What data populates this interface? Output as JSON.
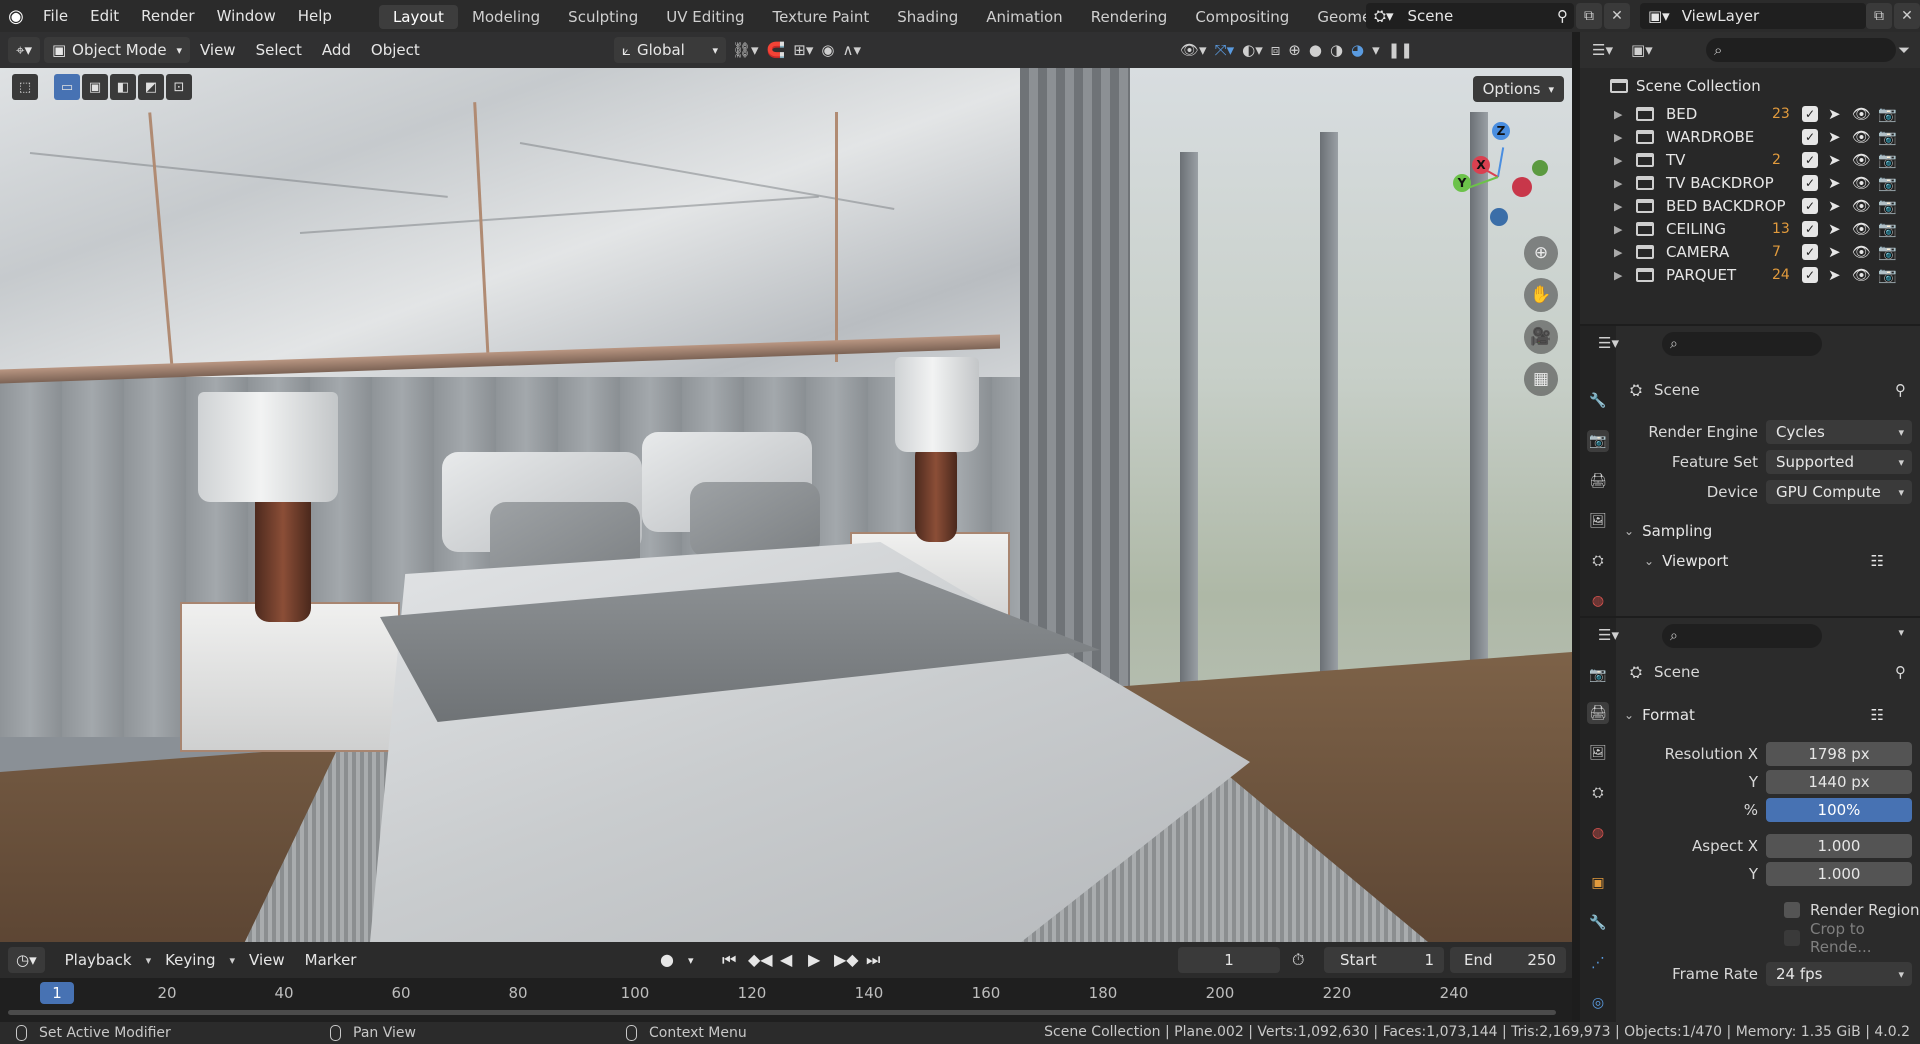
{
  "topbar": {
    "menus": [
      "File",
      "Edit",
      "Render",
      "Window",
      "Help"
    ],
    "workspaces": [
      "Layout",
      "Modeling",
      "Sculpting",
      "UV Editing",
      "Texture Paint",
      "Shading",
      "Animation",
      "Rendering",
      "Compositing",
      "Geomet"
    ],
    "active_workspace": "Layout",
    "scene_name": "Scene",
    "view_layer": "ViewLayer"
  },
  "viewport": {
    "mode": "Object Mode",
    "menus": [
      "View",
      "Select",
      "Add",
      "Object"
    ],
    "transform_orientation": "Global",
    "options_label": "Options",
    "gizmo": {
      "z": "Z",
      "x": "X",
      "y": "Y"
    }
  },
  "timeline": {
    "menus": [
      "Playback",
      "Keying",
      "View",
      "Marker"
    ],
    "current_frame": "1",
    "start_label": "Start",
    "start_value": "1",
    "end_label": "End",
    "end_value": "250",
    "ruler_ticks": [
      "20",
      "40",
      "60",
      "80",
      "100",
      "120",
      "140",
      "160",
      "180",
      "200",
      "220",
      "240"
    ],
    "cursor_frame": "1"
  },
  "statusbar": {
    "hint1": "Set Active Modifier",
    "hint2": "Pan View",
    "hint3": "Context Menu",
    "stats": "Scene Collection | Plane.002 | Verts:1,092,630 | Faces:1,073,144 | Tris:2,169,973 | Objects:1/470 | Memory: 1.35 GiB | 4.0.2"
  },
  "outliner": {
    "root": "Scene Collection",
    "items": [
      {
        "name": "BED",
        "badge": "23"
      },
      {
        "name": "WARDROBE",
        "badge": ""
      },
      {
        "name": "TV",
        "badge": "2"
      },
      {
        "name": "TV BACKDROP",
        "badge": ""
      },
      {
        "name": "BED BACKDROP",
        "badge": ""
      },
      {
        "name": "CEILING",
        "badge": "13"
      },
      {
        "name": "CAMERA",
        "badge": "7"
      },
      {
        "name": "PARQUET",
        "badge": "24"
      }
    ]
  },
  "render_props": {
    "title": "Scene",
    "render_engine_label": "Render Engine",
    "render_engine": "Cycles",
    "feature_set_label": "Feature Set",
    "feature_set": "Supported",
    "device_label": "Device",
    "device": "GPU Compute",
    "sampling": "Sampling",
    "viewport": "Viewport"
  },
  "output_props": {
    "title": "Scene",
    "format": "Format",
    "res_x_label": "Resolution X",
    "res_x": "1798 px",
    "res_y_label": "Y",
    "res_y": "1440 px",
    "pct_label": "%",
    "pct": "100%",
    "aspect_x_label": "Aspect X",
    "aspect_x": "1.000",
    "aspect_y_label": "Y",
    "aspect_y": "1.000",
    "render_region": "Render Region",
    "crop": "Crop to Rende...",
    "frame_rate_label": "Frame Rate",
    "frame_rate": "24 fps"
  },
  "colors": {
    "accent": "#4772b3",
    "badge_orange": "#e29b3d"
  }
}
